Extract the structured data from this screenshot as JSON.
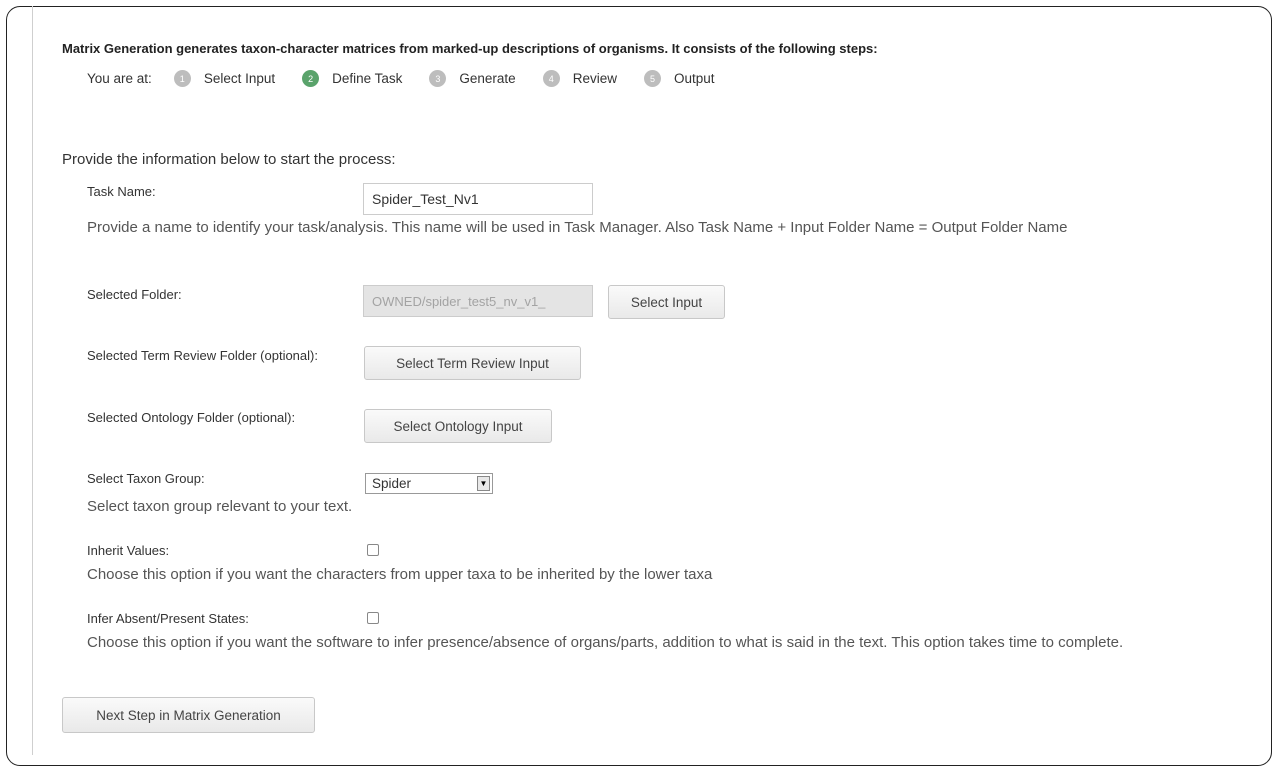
{
  "intro": "Matrix Generation generates taxon-character matrices from marked-up descriptions of organisms. It consists of the following steps:",
  "progress": {
    "label": "You are at:",
    "steps": [
      {
        "num": "1",
        "label": "Select Input"
      },
      {
        "num": "2",
        "label": "Define Task"
      },
      {
        "num": "3",
        "label": "Generate"
      },
      {
        "num": "4",
        "label": "Review"
      },
      {
        "num": "5",
        "label": "Output"
      }
    ],
    "current_step": 2
  },
  "form": {
    "heading": "Provide the information below to start the process:",
    "task_name": {
      "label": "Task Name:",
      "value": "Spider_Test_Nv1",
      "help": "Provide a name to identify your task/analysis. This name will be used in Task Manager. Also Task Name + Input Folder Name = Output Folder Name"
    },
    "selected_folder": {
      "label": "Selected Folder:",
      "value": "OWNED/spider_test5_nv_v1_",
      "button": "Select Input"
    },
    "term_review": {
      "label": "Selected Term Review Folder (optional):",
      "button": "Select Term Review Input"
    },
    "ontology": {
      "label": "Selected Ontology Folder (optional):",
      "button": "Select Ontology Input"
    },
    "taxon_group": {
      "label": "Select Taxon Group:",
      "value": "Spider",
      "help": "Select taxon group relevant to your text."
    },
    "inherit_values": {
      "label": "Inherit Values:",
      "checked": false,
      "help": "Choose this option if you want the characters from upper taxa to be inherited by the lower taxa"
    },
    "infer_states": {
      "label": "Infer Absent/Present States:",
      "checked": false,
      "help": "Choose this option if you want the software to infer presence/absence of organs/parts, addition to what is said in the text. This option takes time to complete."
    },
    "next_button": "Next Step in Matrix Generation"
  },
  "colors": {
    "active_step": "#5aa36b",
    "inactive_step": "#bdbdbd"
  }
}
